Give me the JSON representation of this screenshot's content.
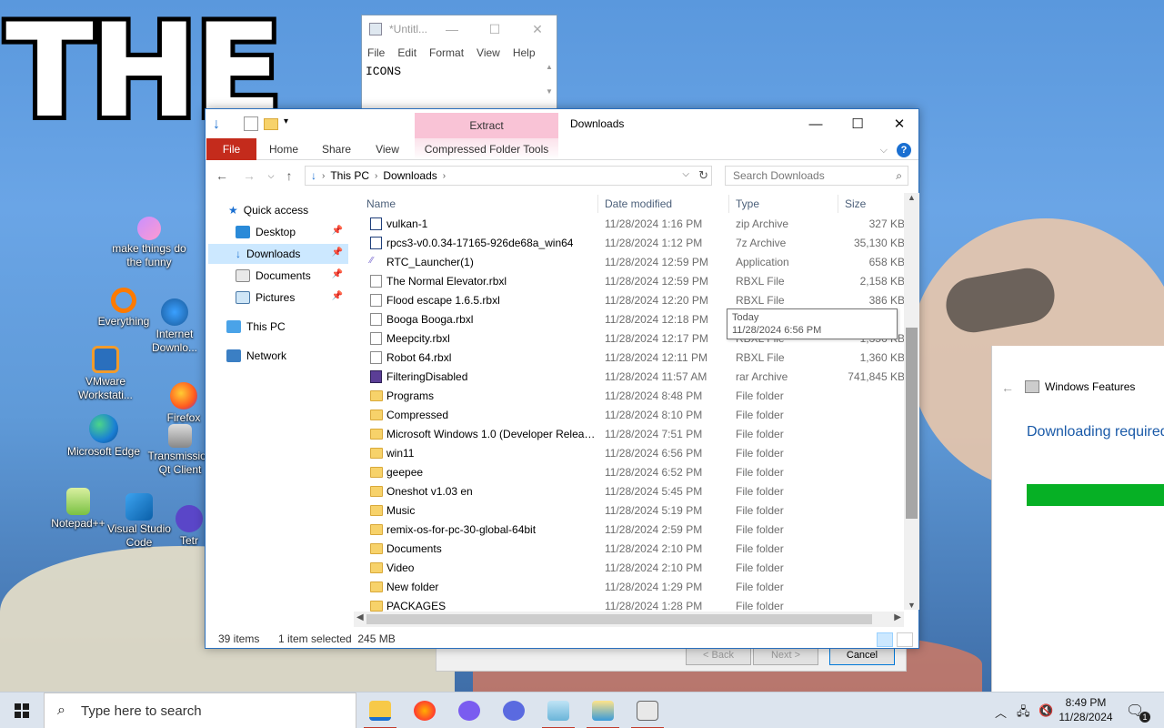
{
  "wallpaper": {
    "big_text": "THE"
  },
  "desktop_icons": [
    {
      "label": "make things do the funny",
      "icon": "sparkle-icon"
    },
    {
      "label": "Everything",
      "icon": "search-ring-icon"
    },
    {
      "label": "Internet Downlo...",
      "icon": "globe-arrow-icon"
    },
    {
      "label": "VMware Workstati...",
      "icon": "vmware-icon"
    },
    {
      "label": "Firefox",
      "icon": "firefox-icon"
    },
    {
      "label": "Microsoft Edge",
      "icon": "edge-icon"
    },
    {
      "label": "Transmission Qt Client",
      "icon": "transmission-icon"
    },
    {
      "label": "Notepad++",
      "icon": "notepadpp-icon"
    },
    {
      "label": "Visual Studio Code",
      "icon": "vscode-icon"
    },
    {
      "label": "Tetr",
      "icon": "tetr-icon"
    }
  ],
  "notepad": {
    "title": "*Untitl...",
    "menu": [
      "File",
      "Edit",
      "Format",
      "View",
      "Help"
    ],
    "content": "ICONS"
  },
  "windows_features": {
    "title": "Windows Features",
    "status": "Downloading required",
    "progress": 1.0,
    "buttons": {
      "back": "< Back",
      "next": "Next >",
      "cancel": "Cancel"
    }
  },
  "explorer": {
    "title": "Downloads",
    "context_tab": "Extract",
    "context_group": "Compressed Folder Tools",
    "ribbon_tabs": [
      "File",
      "Home",
      "Share",
      "View"
    ],
    "address": {
      "segments": [
        "This PC",
        "Downloads"
      ]
    },
    "search_placeholder": "Search Downloads",
    "nav": {
      "quick_access": "Quick access",
      "pinned": [
        "Desktop",
        "Downloads",
        "Documents",
        "Pictures"
      ],
      "this_pc": "This PC",
      "network": "Network"
    },
    "columns": {
      "name": "Name",
      "date": "Date modified",
      "type": "Type",
      "size": "Size"
    },
    "rows": [
      {
        "name": "vulkan-1",
        "date": "11/28/2024 1:16 PM",
        "type": "zip Archive",
        "size": "327 KB",
        "kind": "zip"
      },
      {
        "name": "rpcs3-v0.0.34-17165-926de68a_win64",
        "date": "11/28/2024 1:12 PM",
        "type": "7z Archive",
        "size": "35,130 KB",
        "kind": "zip"
      },
      {
        "name": "RTC_Launcher(1)",
        "date": "11/28/2024 12:59 PM",
        "type": "Application",
        "size": "658 KB",
        "kind": "app"
      },
      {
        "name": "The Normal Elevator.rbxl",
        "date": "11/28/2024 12:59 PM",
        "type": "RBXL File",
        "size": "2,158 KB",
        "kind": "file"
      },
      {
        "name": "Flood escape 1.6.5.rbxl",
        "date": "11/28/2024 12:20 PM",
        "type": "RBXL File",
        "size": "386 KB",
        "kind": "file"
      },
      {
        "name": "Booga Booga.rbxl",
        "date": "11/28/2024 12:18 PM",
        "type": "RBXL File",
        "size": "",
        "kind": "file"
      },
      {
        "name": "Meepcity.rbxl",
        "date": "11/28/2024 12:17 PM",
        "type": "RBXL File",
        "size": "1,356 KB",
        "kind": "file"
      },
      {
        "name": "Robot 64.rbxl",
        "date": "11/28/2024 12:11 PM",
        "type": "RBXL File",
        "size": "1,360 KB",
        "kind": "file"
      },
      {
        "name": "FilteringDisabled",
        "date": "11/28/2024 11:57 AM",
        "type": "rar Archive",
        "size": "741,845 KB",
        "kind": "rar"
      },
      {
        "name": "Programs",
        "date": "11/28/2024 8:48 PM",
        "type": "File folder",
        "size": "",
        "kind": "folder"
      },
      {
        "name": "Compressed",
        "date": "11/28/2024 8:10 PM",
        "type": "File folder",
        "size": "",
        "kind": "folder"
      },
      {
        "name": "Microsoft Windows 1.0 (Developer Releas...",
        "date": "11/28/2024 7:51 PM",
        "type": "File folder",
        "size": "",
        "kind": "folder"
      },
      {
        "name": "win11",
        "date": "11/28/2024 6:56 PM",
        "type": "File folder",
        "size": "",
        "kind": "folder"
      },
      {
        "name": "geepee",
        "date": "11/28/2024 6:52 PM",
        "type": "File folder",
        "size": "",
        "kind": "folder"
      },
      {
        "name": "Oneshot v1.03 en",
        "date": "11/28/2024 5:45 PM",
        "type": "File folder",
        "size": "",
        "kind": "folder"
      },
      {
        "name": "Music",
        "date": "11/28/2024 5:19 PM",
        "type": "File folder",
        "size": "",
        "kind": "folder"
      },
      {
        "name": "remix-os-for-pc-30-global-64bit",
        "date": "11/28/2024 2:59 PM",
        "type": "File folder",
        "size": "",
        "kind": "folder"
      },
      {
        "name": "Documents",
        "date": "11/28/2024 2:10 PM",
        "type": "File folder",
        "size": "",
        "kind": "folder"
      },
      {
        "name": "Video",
        "date": "11/28/2024 2:10 PM",
        "type": "File folder",
        "size": "",
        "kind": "folder"
      },
      {
        "name": "New folder",
        "date": "11/28/2024 1:29 PM",
        "type": "File folder",
        "size": "",
        "kind": "folder"
      },
      {
        "name": "PACKAGES",
        "date": "11/28/2024 1:28 PM",
        "type": "File folder",
        "size": "",
        "kind": "folder"
      }
    ],
    "tooltip": {
      "line1": "Today",
      "line2": "11/28/2024 6:56 PM"
    },
    "status": {
      "count": "39 items",
      "selection": "1 item selected  245 MB"
    }
  },
  "taskbar": {
    "search_placeholder": "Type here to search",
    "apps": [
      "file-explorer-icon",
      "firefox-icon",
      "bluetooth-app-icon",
      "cloud-app-icon",
      "notepad-icon",
      "installer-icon",
      "features-icon"
    ],
    "clock": {
      "time": "8:49 PM",
      "date": "11/28/2024"
    },
    "notification_count": "1"
  }
}
